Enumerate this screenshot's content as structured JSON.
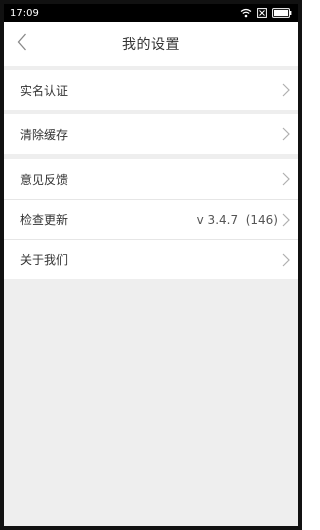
{
  "status_bar": {
    "time": "17:09"
  },
  "header": {
    "title": "我的设置"
  },
  "settings": {
    "real_name": {
      "label": "实名认证"
    },
    "clear_cache": {
      "label": "清除缓存"
    },
    "feedback": {
      "label": "意见反馈"
    },
    "check_update": {
      "label": "检查更新",
      "value": "v 3.4.7  (146)"
    },
    "about_us": {
      "label": "关于我们"
    }
  },
  "icons": {
    "back": "chevron-left-icon",
    "row_arrow": "chevron-right-icon",
    "wifi": "wifi-icon",
    "sim": "sim-blocked-icon",
    "battery": "battery-icon"
  },
  "colors": {
    "background": "#eeeeee",
    "surface": "#ffffff",
    "text": "#333333",
    "chevron": "#b0b0b0",
    "status_bar": "#000000"
  }
}
